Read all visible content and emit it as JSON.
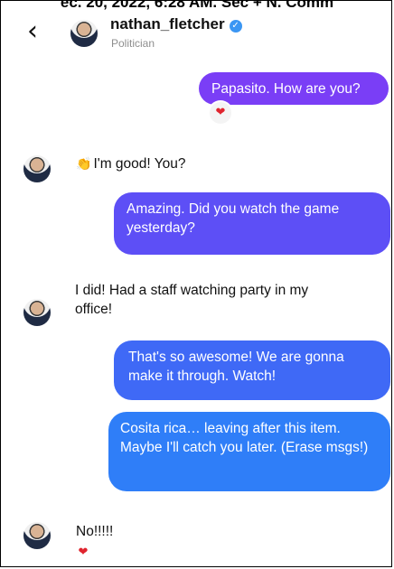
{
  "caption": "ec. 20, 2022, 6:28 AM. Sec + N. Comm",
  "header": {
    "back_glyph": "‹",
    "username": "nathan_fletcher",
    "subtitle": "Politician",
    "verified_icon": "verified-badge-icon"
  },
  "messages": [
    {
      "side": "outgoing",
      "text": "Papasito. How are you?",
      "reaction": "❤"
    },
    {
      "side": "incoming",
      "emoji": "👏",
      "text": "I'm good! You?"
    },
    {
      "side": "outgoing",
      "text": "Amazing. Did you watch the game yesterday?"
    },
    {
      "side": "incoming",
      "text": "I did! Had a staff watching party in my office!"
    },
    {
      "side": "outgoing",
      "text": "That's so awesome! We are gonna make it through. Watch!"
    },
    {
      "side": "outgoing",
      "text": "Cosita rica… leaving after this item. Maybe I'll catch you later. (Erase msgs!)"
    },
    {
      "side": "incoming",
      "text": "No!!!!!",
      "reaction": "❤"
    }
  ],
  "colors": {
    "bubble_1": "#7a3ef6",
    "bubble_2": "#5d4ff6",
    "bubble_3": "#3f69f6",
    "bubble_4": "#2f7ef8",
    "verified": "#3b96f3",
    "heart": "#e0242e"
  }
}
